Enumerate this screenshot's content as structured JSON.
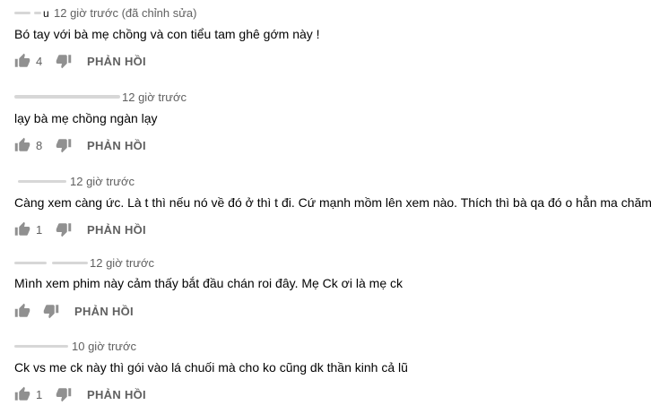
{
  "comments": [
    {
      "author_visible": "u",
      "timestamp": "12 giờ trước (đã chỉnh sửa)",
      "text": "Bó tay với bà mẹ chồng và con tiểu tam ghê gớm này !",
      "likes": "4",
      "reply_label": "PHẢN HỒI"
    },
    {
      "author_visible": "",
      "timestamp": "12 giờ trước",
      "text": "lạy bà mẹ chồng ngàn lạy",
      "likes": "8",
      "reply_label": "PHẢN HỒI"
    },
    {
      "author_visible": "",
      "timestamp": "12 giờ trước",
      "text": "Càng xem càng ức. Là t thì nếu nó về đó ở thì t đi. Cứ mạnh mồm lên xem nào. Thích thì bà qa đó o hẳn ma chăm",
      "likes": "1",
      "reply_label": "PHẢN HỒI"
    },
    {
      "author_visible": "",
      "timestamp": "12 giờ trước",
      "text": "Mình xem phim này cảm thấy bắt đầu chán roi đây. Mẹ Ck ơi là mẹ ck",
      "likes": "",
      "reply_label": "PHẢN HỒI"
    },
    {
      "author_visible": "",
      "timestamp": "10 giờ trước",
      "text": "Ck vs me ck này thì gói vào lá chuối mà cho ko cũng dk thần kinh cả lũ",
      "likes": "1",
      "reply_label": "PHẢN HỒI"
    }
  ],
  "icons": {
    "like": "thumbs-up-icon",
    "dislike": "thumbs-down-icon"
  },
  "colors": {
    "text": "#030303",
    "secondary": "#606060",
    "icon": "#909090"
  }
}
